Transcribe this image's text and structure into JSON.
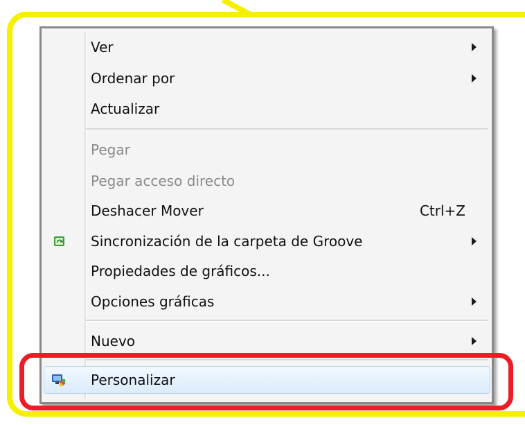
{
  "context_menu": {
    "items": [
      {
        "label": "Ver",
        "submenu": true,
        "enabled": true
      },
      {
        "label": "Ordenar por",
        "submenu": true,
        "enabled": true
      },
      {
        "label": "Actualizar",
        "submenu": false,
        "enabled": true
      },
      {
        "label": "Pegar",
        "submenu": false,
        "enabled": false
      },
      {
        "label": "Pegar acceso directo",
        "submenu": false,
        "enabled": false
      },
      {
        "label": "Deshacer Mover",
        "shortcut": "Ctrl+Z",
        "submenu": false,
        "enabled": true
      },
      {
        "label": "Sincronización de la carpeta de Groove",
        "submenu": true,
        "enabled": true,
        "icon": "groove-sync-icon"
      },
      {
        "label": "Propiedades de gráficos...",
        "submenu": false,
        "enabled": true
      },
      {
        "label": "Opciones gráficas",
        "submenu": true,
        "enabled": true
      },
      {
        "label": "Nuevo",
        "submenu": true,
        "enabled": true
      },
      {
        "label": "Personalizar",
        "submenu": false,
        "enabled": true,
        "highlighted": true,
        "icon": "personalize-display-icon"
      }
    ]
  },
  "annotations": {
    "highlight_color": "#ee1c24",
    "frame_color": "#f4f000"
  }
}
